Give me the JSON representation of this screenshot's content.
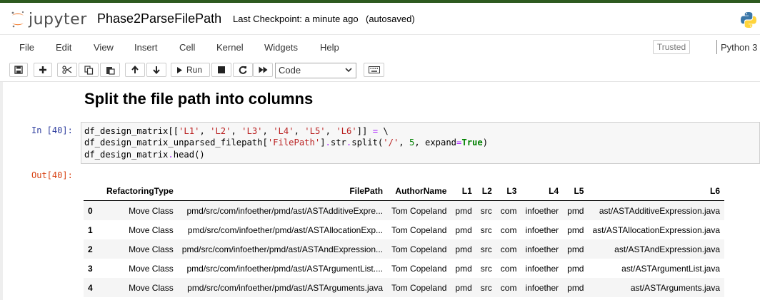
{
  "app": {
    "logo_text": "jupyter",
    "notebook_title": "Phase2ParseFilePath",
    "checkpoint": "Last Checkpoint: a minute ago",
    "autosave": "(autosaved)"
  },
  "menu": {
    "items": [
      "File",
      "Edit",
      "View",
      "Insert",
      "Cell",
      "Kernel",
      "Widgets",
      "Help"
    ],
    "trusted": "Trusted",
    "kernel": "Python 3"
  },
  "toolbar": {
    "run_label": "Run",
    "cell_type": "Code",
    "icons": [
      "save-icon",
      "plus-icon",
      "cut-icon",
      "copy-icon",
      "paste-icon",
      "arrow-up-icon",
      "arrow-down-icon",
      "run-icon",
      "stop-icon",
      "restart-icon",
      "fast-forward-icon",
      "keyboard-icon"
    ]
  },
  "cells": {
    "markdown_heading": "Split the file path into columns",
    "in_prompt": "In [40]:",
    "out_prompt": "Out[40]:"
  },
  "dataframe": {
    "columns": [
      "",
      "RefactoringType",
      "FilePath",
      "AuthorName",
      "L1",
      "L2",
      "L3",
      "L4",
      "L5",
      "L6"
    ],
    "rows": [
      [
        "0",
        "Move Class",
        "pmd/src/com/infoether/pmd/ast/ASTAdditiveExpre...",
        "Tom Copeland",
        "pmd",
        "src",
        "com",
        "infoether",
        "pmd",
        "ast/ASTAdditiveExpression.java"
      ],
      [
        "1",
        "Move Class",
        "pmd/src/com/infoether/pmd/ast/ASTAllocationExp...",
        "Tom Copeland",
        "pmd",
        "src",
        "com",
        "infoether",
        "pmd",
        "ast/ASTAllocationExpression.java"
      ],
      [
        "2",
        "Move Class",
        "pmd/src/com/infoether/pmd/ast/ASTAndExpression...",
        "Tom Copeland",
        "pmd",
        "src",
        "com",
        "infoether",
        "pmd",
        "ast/ASTAndExpression.java"
      ],
      [
        "3",
        "Move Class",
        "pmd/src/com/infoether/pmd/ast/ASTArgumentList....",
        "Tom Copeland",
        "pmd",
        "src",
        "com",
        "infoether",
        "pmd",
        "ast/ASTArgumentList.java"
      ],
      [
        "4",
        "Move Class",
        "pmd/src/com/infoether/pmd/ast/ASTArguments.java",
        "Tom Copeland",
        "pmd",
        "src",
        "com",
        "infoether",
        "pmd",
        "ast/ASTArguments.java"
      ]
    ]
  },
  "colors": {
    "logo_orange": "#f37726",
    "in_prompt": "#303f9f",
    "out_prompt": "#d84315"
  }
}
